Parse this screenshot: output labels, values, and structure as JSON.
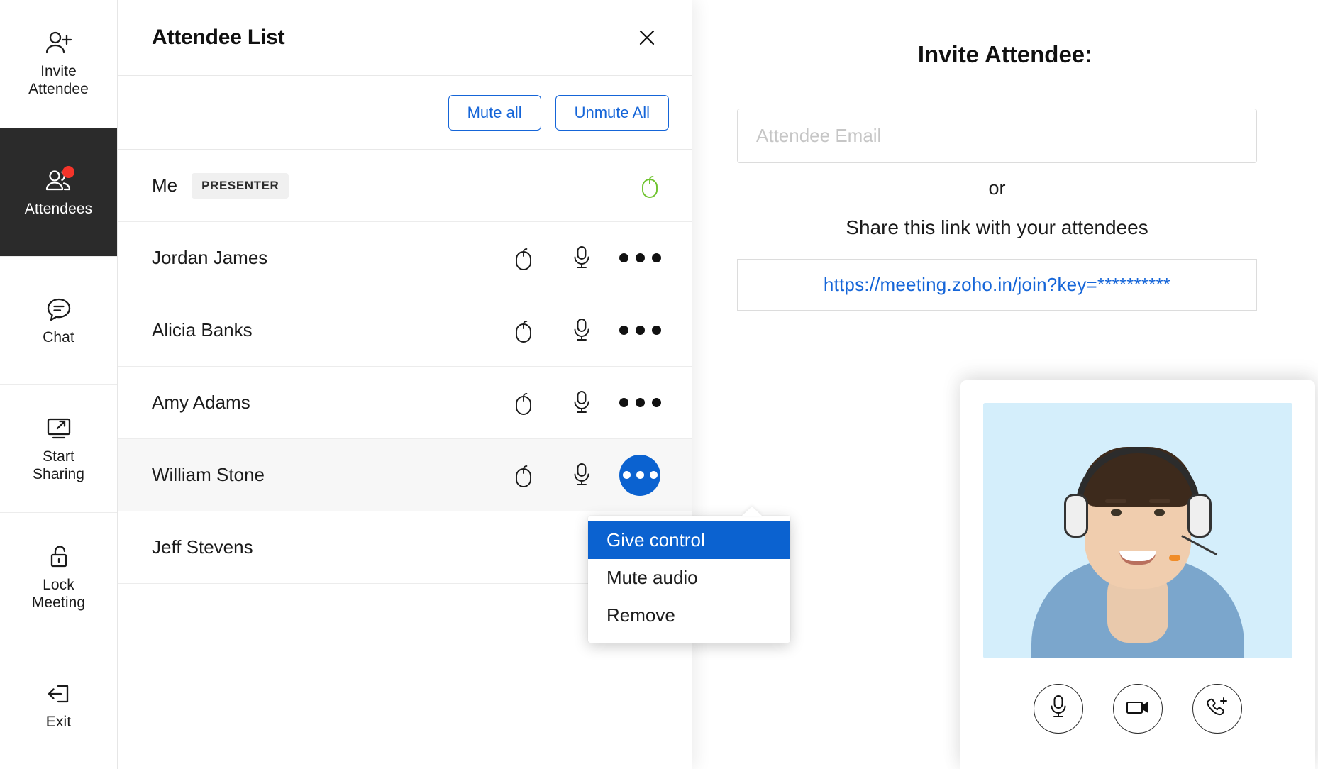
{
  "sidebar": {
    "items": [
      {
        "label": "Invite\nAttendee",
        "icon": "user-plus-icon",
        "name": "invite-attendee",
        "active": false,
        "badge": false
      },
      {
        "label": "Attendees",
        "icon": "users-icon",
        "name": "attendees",
        "active": true,
        "badge": true
      },
      {
        "label": "Chat",
        "icon": "chat-bubble-icon",
        "name": "chat",
        "active": false,
        "badge": false
      },
      {
        "label": "Start\nSharing",
        "icon": "screen-share-icon",
        "name": "start-sharing",
        "active": false,
        "badge": false
      },
      {
        "label": "Lock\nMeeting",
        "icon": "lock-icon",
        "name": "lock-meeting",
        "active": false,
        "badge": false
      },
      {
        "label": "Exit",
        "icon": "exit-icon",
        "name": "exit",
        "active": false,
        "badge": false
      }
    ]
  },
  "panel": {
    "title": "Attendee List",
    "close_label": "×",
    "mute_all_label": "Mute all",
    "unmute_all_label": "Unmute All",
    "attendees": [
      {
        "name": "Me",
        "badge": "PRESENTER",
        "mouse": true,
        "mouse_color": "#6ec32d",
        "mic": false,
        "more": false,
        "highlight": false,
        "more_active": false
      },
      {
        "name": "Jordan James",
        "badge": "",
        "mouse": true,
        "mouse_color": "#1b1b1b",
        "mic": true,
        "more": true,
        "highlight": false,
        "more_active": false
      },
      {
        "name": "Alicia Banks",
        "badge": "",
        "mouse": true,
        "mouse_color": "#1b1b1b",
        "mic": true,
        "more": true,
        "highlight": false,
        "more_active": false
      },
      {
        "name": "Amy Adams",
        "badge": "",
        "mouse": true,
        "mouse_color": "#1b1b1b",
        "mic": true,
        "more": true,
        "highlight": false,
        "more_active": false
      },
      {
        "name": "William Stone",
        "badge": "",
        "mouse": true,
        "mouse_color": "#1b1b1b",
        "mic": true,
        "more": true,
        "highlight": true,
        "more_active": true
      },
      {
        "name": "Jeff Stevens",
        "badge": "",
        "mouse": false,
        "mouse_color": "#1b1b1b",
        "mic": false,
        "more": false,
        "highlight": false,
        "more_active": false
      }
    ]
  },
  "context_menu": {
    "items": [
      {
        "label": "Give control",
        "selected": true
      },
      {
        "label": "Mute audio",
        "selected": false
      },
      {
        "label": "Remove",
        "selected": false
      }
    ]
  },
  "invite": {
    "title": "Invite Attendee:",
    "email_placeholder": "Attendee Email",
    "email_value": "",
    "or_label": "or",
    "share_label": "Share this link with your attendees",
    "link": "https://meeting.zoho.in/join?key=**********"
  },
  "video": {
    "controls": [
      {
        "name": "microphone-icon",
        "label": "Microphone"
      },
      {
        "name": "video-camera-icon",
        "label": "Camera"
      },
      {
        "name": "phone-add-icon",
        "label": "Add Call"
      }
    ]
  },
  "colors": {
    "accent_blue": "#0b62d0",
    "link_blue": "#1565d8",
    "badge_red": "#f5342a",
    "mouse_green": "#6ec32d",
    "rail_active_bg": "#2b2b2b"
  }
}
